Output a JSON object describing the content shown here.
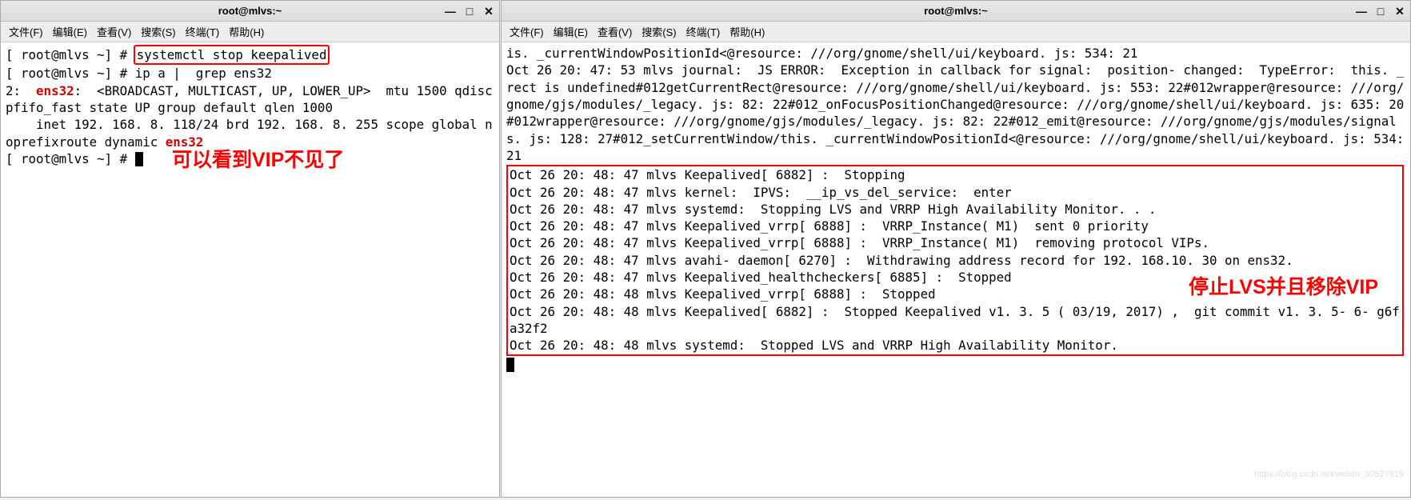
{
  "left_window": {
    "title": "root@mlvs:~",
    "menubar": [
      "文件(F)",
      "编辑(E)",
      "查看(V)",
      "搜索(S)",
      "终端(T)",
      "帮助(H)"
    ],
    "prompt1": "[ root@mlvs ~] # ",
    "cmd1": "systemctl stop keepalived",
    "prompt2": "[ root@mlvs ~] # ",
    "cmd2": "ip a |  grep ens32",
    "output_line1_a": "2:  ",
    "output_line1_iface": "ens32",
    "output_line1_b": ":  <BROADCAST, MULTICAST, UP, LOWER_UP>  mtu 1500 qdisc pfifo_fast state UP group default qlen 1000",
    "output_line2": "    inet 192. 168. 8. 118/24 brd 192. 168. 8. 255 scope global noprefixroute dynamic ",
    "output_line2_iface": "ens32",
    "prompt3": "[ root@mlvs ~] # ",
    "annotation": "可以看到VIP不见了"
  },
  "right_window": {
    "title": "root@mlvs:~",
    "menubar": [
      "文件(F)",
      "编辑(E)",
      "查看(V)",
      "搜索(S)",
      "终端(T)",
      "帮助(H)"
    ],
    "top_log": "is. _currentWindowPositionId<@resource: ///org/gnome/shell/ui/keyboard. js: 534: 21\nOct 26 20: 47: 53 mlvs journal:  JS ERROR:  Exception in callback for signal:  position- changed:  TypeError:  this. _rect is undefined#012getCurrentRect@resource: ///org/gnome/shell/ui/keyboard. js: 553: 22#012wrapper@resource: ///org/gnome/gjs/modules/_legacy. js: 82: 22#012_onFocusPositionChanged@resource: ///org/gnome/shell/ui/keyboard. js: 635: 20#012wrapper@resource: ///org/gnome/gjs/modules/_legacy. js: 82: 22#012_emit@resource: ///org/gnome/gjs/modules/signals. js: 128: 27#012_setCurrentWindow/this. _currentWindowPositionId<@resource: ///org/gnome/shell/ui/keyboard. js: 534: 21",
    "boxed_log": "Oct 26 20: 48: 47 mlvs Keepalived[ 6882] :  Stopping\nOct 26 20: 48: 47 mlvs kernel:  IPVS:  __ip_vs_del_service:  enter\nOct 26 20: 48: 47 mlvs systemd:  Stopping LVS and VRRP High Availability Monitor. . .\nOct 26 20: 48: 47 mlvs Keepalived_vrrp[ 6888] :  VRRP_Instance( M1)  sent 0 priority\nOct 26 20: 48: 47 mlvs Keepalived_vrrp[ 6888] :  VRRP_Instance( M1)  removing protocol VIPs.\nOct 26 20: 48: 47 mlvs avahi- daemon[ 6270] :  Withdrawing address record for 192. 168.10. 30 on ens32.\nOct 26 20: 48: 47 mlvs Keepalived_healthcheckers[ 6885] :  Stopped\nOct 26 20: 48: 48 mlvs Keepalived_vrrp[ 6888] :  Stopped\nOct 26 20: 48: 48 mlvs Keepalived[ 6882] :  Stopped Keepalived v1. 3. 5 ( 03/19, 2017) ,  git commit v1. 3. 5- 6- g6fa32f2\nOct 26 20: 48: 48 mlvs systemd:  Stopped LVS and VRRP High Availability Monitor.",
    "annotation": "停止LVS并且移除VIP",
    "watermark": "https://blog.csdn.net/weixin_30527919"
  }
}
